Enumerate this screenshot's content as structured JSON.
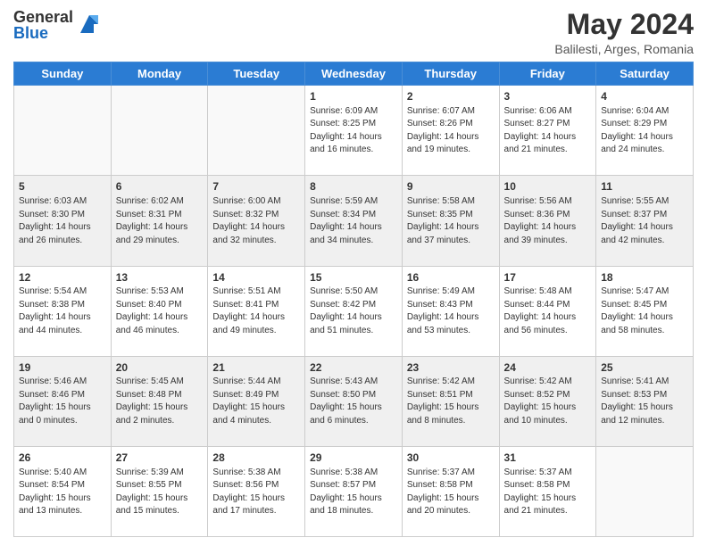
{
  "header": {
    "logo_general": "General",
    "logo_blue": "Blue",
    "month_year": "May 2024",
    "location": "Balilesti, Arges, Romania"
  },
  "weekdays": [
    "Sunday",
    "Monday",
    "Tuesday",
    "Wednesday",
    "Thursday",
    "Friday",
    "Saturday"
  ],
  "weeks": [
    [
      {
        "day": "",
        "info": "",
        "empty": true
      },
      {
        "day": "",
        "info": "",
        "empty": true
      },
      {
        "day": "",
        "info": "",
        "empty": true
      },
      {
        "day": "1",
        "info": "Sunrise: 6:09 AM\nSunset: 8:25 PM\nDaylight: 14 hours\nand 16 minutes."
      },
      {
        "day": "2",
        "info": "Sunrise: 6:07 AM\nSunset: 8:26 PM\nDaylight: 14 hours\nand 19 minutes."
      },
      {
        "day": "3",
        "info": "Sunrise: 6:06 AM\nSunset: 8:27 PM\nDaylight: 14 hours\nand 21 minutes."
      },
      {
        "day": "4",
        "info": "Sunrise: 6:04 AM\nSunset: 8:29 PM\nDaylight: 14 hours\nand 24 minutes."
      }
    ],
    [
      {
        "day": "5",
        "info": "Sunrise: 6:03 AM\nSunset: 8:30 PM\nDaylight: 14 hours\nand 26 minutes.",
        "shaded": true
      },
      {
        "day": "6",
        "info": "Sunrise: 6:02 AM\nSunset: 8:31 PM\nDaylight: 14 hours\nand 29 minutes.",
        "shaded": true
      },
      {
        "day": "7",
        "info": "Sunrise: 6:00 AM\nSunset: 8:32 PM\nDaylight: 14 hours\nand 32 minutes.",
        "shaded": true
      },
      {
        "day": "8",
        "info": "Sunrise: 5:59 AM\nSunset: 8:34 PM\nDaylight: 14 hours\nand 34 minutes.",
        "shaded": true
      },
      {
        "day": "9",
        "info": "Sunrise: 5:58 AM\nSunset: 8:35 PM\nDaylight: 14 hours\nand 37 minutes.",
        "shaded": true
      },
      {
        "day": "10",
        "info": "Sunrise: 5:56 AM\nSunset: 8:36 PM\nDaylight: 14 hours\nand 39 minutes.",
        "shaded": true
      },
      {
        "day": "11",
        "info": "Sunrise: 5:55 AM\nSunset: 8:37 PM\nDaylight: 14 hours\nand 42 minutes.",
        "shaded": true
      }
    ],
    [
      {
        "day": "12",
        "info": "Sunrise: 5:54 AM\nSunset: 8:38 PM\nDaylight: 14 hours\nand 44 minutes."
      },
      {
        "day": "13",
        "info": "Sunrise: 5:53 AM\nSunset: 8:40 PM\nDaylight: 14 hours\nand 46 minutes."
      },
      {
        "day": "14",
        "info": "Sunrise: 5:51 AM\nSunset: 8:41 PM\nDaylight: 14 hours\nand 49 minutes."
      },
      {
        "day": "15",
        "info": "Sunrise: 5:50 AM\nSunset: 8:42 PM\nDaylight: 14 hours\nand 51 minutes."
      },
      {
        "day": "16",
        "info": "Sunrise: 5:49 AM\nSunset: 8:43 PM\nDaylight: 14 hours\nand 53 minutes."
      },
      {
        "day": "17",
        "info": "Sunrise: 5:48 AM\nSunset: 8:44 PM\nDaylight: 14 hours\nand 56 minutes."
      },
      {
        "day": "18",
        "info": "Sunrise: 5:47 AM\nSunset: 8:45 PM\nDaylight: 14 hours\nand 58 minutes."
      }
    ],
    [
      {
        "day": "19",
        "info": "Sunrise: 5:46 AM\nSunset: 8:46 PM\nDaylight: 15 hours\nand 0 minutes.",
        "shaded": true
      },
      {
        "day": "20",
        "info": "Sunrise: 5:45 AM\nSunset: 8:48 PM\nDaylight: 15 hours\nand 2 minutes.",
        "shaded": true
      },
      {
        "day": "21",
        "info": "Sunrise: 5:44 AM\nSunset: 8:49 PM\nDaylight: 15 hours\nand 4 minutes.",
        "shaded": true
      },
      {
        "day": "22",
        "info": "Sunrise: 5:43 AM\nSunset: 8:50 PM\nDaylight: 15 hours\nand 6 minutes.",
        "shaded": true
      },
      {
        "day": "23",
        "info": "Sunrise: 5:42 AM\nSunset: 8:51 PM\nDaylight: 15 hours\nand 8 minutes.",
        "shaded": true
      },
      {
        "day": "24",
        "info": "Sunrise: 5:42 AM\nSunset: 8:52 PM\nDaylight: 15 hours\nand 10 minutes.",
        "shaded": true
      },
      {
        "day": "25",
        "info": "Sunrise: 5:41 AM\nSunset: 8:53 PM\nDaylight: 15 hours\nand 12 minutes.",
        "shaded": true
      }
    ],
    [
      {
        "day": "26",
        "info": "Sunrise: 5:40 AM\nSunset: 8:54 PM\nDaylight: 15 hours\nand 13 minutes."
      },
      {
        "day": "27",
        "info": "Sunrise: 5:39 AM\nSunset: 8:55 PM\nDaylight: 15 hours\nand 15 minutes."
      },
      {
        "day": "28",
        "info": "Sunrise: 5:38 AM\nSunset: 8:56 PM\nDaylight: 15 hours\nand 17 minutes."
      },
      {
        "day": "29",
        "info": "Sunrise: 5:38 AM\nSunset: 8:57 PM\nDaylight: 15 hours\nand 18 minutes."
      },
      {
        "day": "30",
        "info": "Sunrise: 5:37 AM\nSunset: 8:58 PM\nDaylight: 15 hours\nand 20 minutes."
      },
      {
        "day": "31",
        "info": "Sunrise: 5:37 AM\nSunset: 8:58 PM\nDaylight: 15 hours\nand 21 minutes."
      },
      {
        "day": "",
        "info": "",
        "empty": true
      }
    ]
  ]
}
